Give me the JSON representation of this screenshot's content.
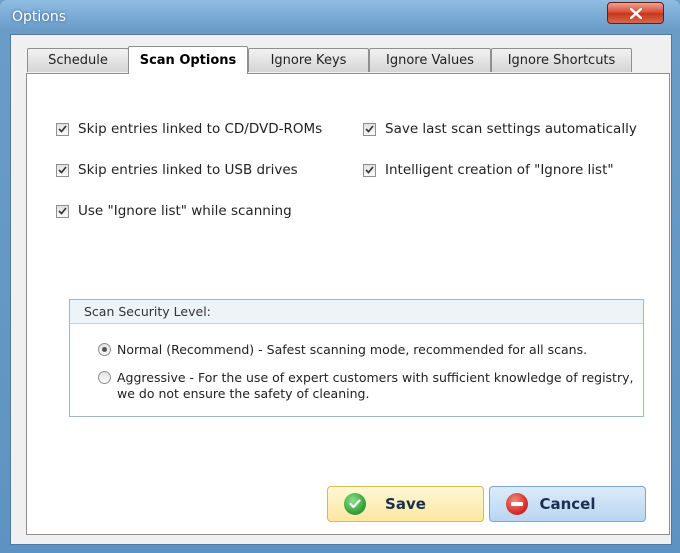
{
  "window": {
    "title": "Options"
  },
  "tabs": [
    "Schedule",
    "Scan Options",
    "Ignore Keys",
    "Ignore Values",
    "Ignore Shortcuts"
  ],
  "active_tab": "Scan Options",
  "options": {
    "skip_cd": "Skip entries linked to CD/DVD-ROMs",
    "skip_usb": "Skip entries linked to USB drives",
    "use_ignore": "Use \"Ignore list\" while scanning",
    "save_settings": "Save last scan settings automatically",
    "intelligent": "Intelligent creation of \"Ignore list\""
  },
  "security": {
    "heading": "Scan Security Level:",
    "normal": "Normal (Recommend) - Safest scanning mode, recommended for all scans.",
    "aggressive_line1": "Aggressive - For the use of expert customers with sufficient knowledge of registry,",
    "aggressive_line2": "we do not ensure the safety of cleaning.",
    "selected": "normal"
  },
  "buttons": {
    "save": "Save",
    "cancel": "Cancel"
  },
  "colors": {
    "save_icon": "#3aa33a",
    "cancel_icon": "#d8302a",
    "title_bar": "#6a9cc8"
  },
  "icons": {
    "save": "checkmark-icon",
    "cancel": "minus-icon",
    "close": "close-icon"
  }
}
